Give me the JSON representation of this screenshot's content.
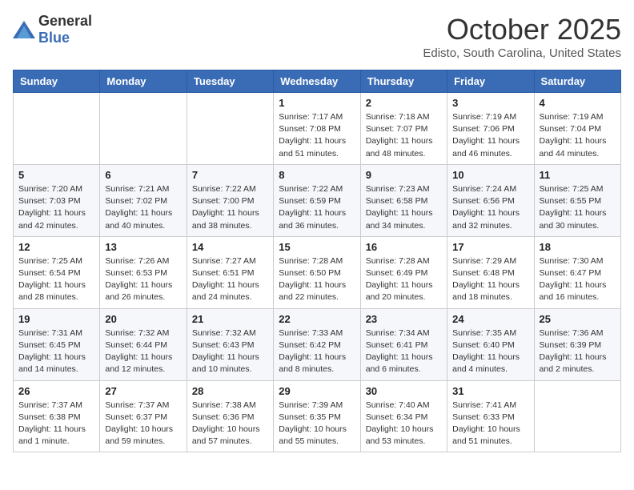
{
  "header": {
    "logo_general": "General",
    "logo_blue": "Blue",
    "month": "October 2025",
    "location": "Edisto, South Carolina, United States"
  },
  "weekdays": [
    "Sunday",
    "Monday",
    "Tuesday",
    "Wednesday",
    "Thursday",
    "Friday",
    "Saturday"
  ],
  "weeks": [
    [
      {
        "day": "",
        "sunrise": "",
        "sunset": "",
        "daylight": ""
      },
      {
        "day": "",
        "sunrise": "",
        "sunset": "",
        "daylight": ""
      },
      {
        "day": "",
        "sunrise": "",
        "sunset": "",
        "daylight": ""
      },
      {
        "day": "1",
        "sunrise": "Sunrise: 7:17 AM",
        "sunset": "Sunset: 7:08 PM",
        "daylight": "Daylight: 11 hours and 51 minutes."
      },
      {
        "day": "2",
        "sunrise": "Sunrise: 7:18 AM",
        "sunset": "Sunset: 7:07 PM",
        "daylight": "Daylight: 11 hours and 48 minutes."
      },
      {
        "day": "3",
        "sunrise": "Sunrise: 7:19 AM",
        "sunset": "Sunset: 7:06 PM",
        "daylight": "Daylight: 11 hours and 46 minutes."
      },
      {
        "day": "4",
        "sunrise": "Sunrise: 7:19 AM",
        "sunset": "Sunset: 7:04 PM",
        "daylight": "Daylight: 11 hours and 44 minutes."
      }
    ],
    [
      {
        "day": "5",
        "sunrise": "Sunrise: 7:20 AM",
        "sunset": "Sunset: 7:03 PM",
        "daylight": "Daylight: 11 hours and 42 minutes."
      },
      {
        "day": "6",
        "sunrise": "Sunrise: 7:21 AM",
        "sunset": "Sunset: 7:02 PM",
        "daylight": "Daylight: 11 hours and 40 minutes."
      },
      {
        "day": "7",
        "sunrise": "Sunrise: 7:22 AM",
        "sunset": "Sunset: 7:00 PM",
        "daylight": "Daylight: 11 hours and 38 minutes."
      },
      {
        "day": "8",
        "sunrise": "Sunrise: 7:22 AM",
        "sunset": "Sunset: 6:59 PM",
        "daylight": "Daylight: 11 hours and 36 minutes."
      },
      {
        "day": "9",
        "sunrise": "Sunrise: 7:23 AM",
        "sunset": "Sunset: 6:58 PM",
        "daylight": "Daylight: 11 hours and 34 minutes."
      },
      {
        "day": "10",
        "sunrise": "Sunrise: 7:24 AM",
        "sunset": "Sunset: 6:56 PM",
        "daylight": "Daylight: 11 hours and 32 minutes."
      },
      {
        "day": "11",
        "sunrise": "Sunrise: 7:25 AM",
        "sunset": "Sunset: 6:55 PM",
        "daylight": "Daylight: 11 hours and 30 minutes."
      }
    ],
    [
      {
        "day": "12",
        "sunrise": "Sunrise: 7:25 AM",
        "sunset": "Sunset: 6:54 PM",
        "daylight": "Daylight: 11 hours and 28 minutes."
      },
      {
        "day": "13",
        "sunrise": "Sunrise: 7:26 AM",
        "sunset": "Sunset: 6:53 PM",
        "daylight": "Daylight: 11 hours and 26 minutes."
      },
      {
        "day": "14",
        "sunrise": "Sunrise: 7:27 AM",
        "sunset": "Sunset: 6:51 PM",
        "daylight": "Daylight: 11 hours and 24 minutes."
      },
      {
        "day": "15",
        "sunrise": "Sunrise: 7:28 AM",
        "sunset": "Sunset: 6:50 PM",
        "daylight": "Daylight: 11 hours and 22 minutes."
      },
      {
        "day": "16",
        "sunrise": "Sunrise: 7:28 AM",
        "sunset": "Sunset: 6:49 PM",
        "daylight": "Daylight: 11 hours and 20 minutes."
      },
      {
        "day": "17",
        "sunrise": "Sunrise: 7:29 AM",
        "sunset": "Sunset: 6:48 PM",
        "daylight": "Daylight: 11 hours and 18 minutes."
      },
      {
        "day": "18",
        "sunrise": "Sunrise: 7:30 AM",
        "sunset": "Sunset: 6:47 PM",
        "daylight": "Daylight: 11 hours and 16 minutes."
      }
    ],
    [
      {
        "day": "19",
        "sunrise": "Sunrise: 7:31 AM",
        "sunset": "Sunset: 6:45 PM",
        "daylight": "Daylight: 11 hours and 14 minutes."
      },
      {
        "day": "20",
        "sunrise": "Sunrise: 7:32 AM",
        "sunset": "Sunset: 6:44 PM",
        "daylight": "Daylight: 11 hours and 12 minutes."
      },
      {
        "day": "21",
        "sunrise": "Sunrise: 7:32 AM",
        "sunset": "Sunset: 6:43 PM",
        "daylight": "Daylight: 11 hours and 10 minutes."
      },
      {
        "day": "22",
        "sunrise": "Sunrise: 7:33 AM",
        "sunset": "Sunset: 6:42 PM",
        "daylight": "Daylight: 11 hours and 8 minutes."
      },
      {
        "day": "23",
        "sunrise": "Sunrise: 7:34 AM",
        "sunset": "Sunset: 6:41 PM",
        "daylight": "Daylight: 11 hours and 6 minutes."
      },
      {
        "day": "24",
        "sunrise": "Sunrise: 7:35 AM",
        "sunset": "Sunset: 6:40 PM",
        "daylight": "Daylight: 11 hours and 4 minutes."
      },
      {
        "day": "25",
        "sunrise": "Sunrise: 7:36 AM",
        "sunset": "Sunset: 6:39 PM",
        "daylight": "Daylight: 11 hours and 2 minutes."
      }
    ],
    [
      {
        "day": "26",
        "sunrise": "Sunrise: 7:37 AM",
        "sunset": "Sunset: 6:38 PM",
        "daylight": "Daylight: 11 hours and 1 minute."
      },
      {
        "day": "27",
        "sunrise": "Sunrise: 7:37 AM",
        "sunset": "Sunset: 6:37 PM",
        "daylight": "Daylight: 10 hours and 59 minutes."
      },
      {
        "day": "28",
        "sunrise": "Sunrise: 7:38 AM",
        "sunset": "Sunset: 6:36 PM",
        "daylight": "Daylight: 10 hours and 57 minutes."
      },
      {
        "day": "29",
        "sunrise": "Sunrise: 7:39 AM",
        "sunset": "Sunset: 6:35 PM",
        "daylight": "Daylight: 10 hours and 55 minutes."
      },
      {
        "day": "30",
        "sunrise": "Sunrise: 7:40 AM",
        "sunset": "Sunset: 6:34 PM",
        "daylight": "Daylight: 10 hours and 53 minutes."
      },
      {
        "day": "31",
        "sunrise": "Sunrise: 7:41 AM",
        "sunset": "Sunset: 6:33 PM",
        "daylight": "Daylight: 10 hours and 51 minutes."
      },
      {
        "day": "",
        "sunrise": "",
        "sunset": "",
        "daylight": ""
      }
    ]
  ]
}
